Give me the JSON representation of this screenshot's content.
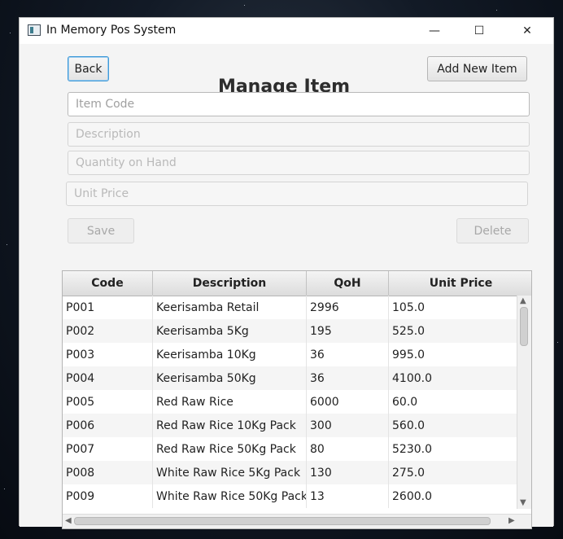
{
  "window": {
    "title": "In Memory Pos System",
    "minimize_glyph": "—",
    "maximize_glyph": "☐",
    "close_glyph": "✕"
  },
  "toolbar": {
    "back_label": "Back",
    "heading": "Manage Item",
    "add_label": "Add New Item"
  },
  "form": {
    "item_code_placeholder": "Item Code",
    "description_placeholder": "Description",
    "qoh_placeholder": "Quantity on Hand",
    "unit_price_placeholder": "Unit Price",
    "save_label": "Save",
    "delete_label": "Delete"
  },
  "table": {
    "columns": [
      "Code",
      "Description",
      "QoH",
      "Unit Price"
    ],
    "rows": [
      [
        "P001",
        "Keerisamba Retail",
        "2996",
        "105.0"
      ],
      [
        "P002",
        "Keerisamba 5Kg",
        "195",
        "525.0"
      ],
      [
        "P003",
        "Keerisamba 10Kg",
        "36",
        "995.0"
      ],
      [
        "P004",
        "Keerisamba 50Kg",
        "36",
        "4100.0"
      ],
      [
        "P005",
        "Red Raw Rice",
        "6000",
        "60.0"
      ],
      [
        "P006",
        "Red Raw Rice 10Kg Pack",
        "300",
        "560.0"
      ],
      [
        "P007",
        "Red Raw Rice 50Kg Pack",
        "80",
        "5230.0"
      ],
      [
        "P008",
        "White Raw Rice 5Kg Pack",
        "130",
        "275.0"
      ],
      [
        "P009",
        "White Raw Rice 50Kg Pack",
        "13",
        "2600.0"
      ]
    ]
  }
}
